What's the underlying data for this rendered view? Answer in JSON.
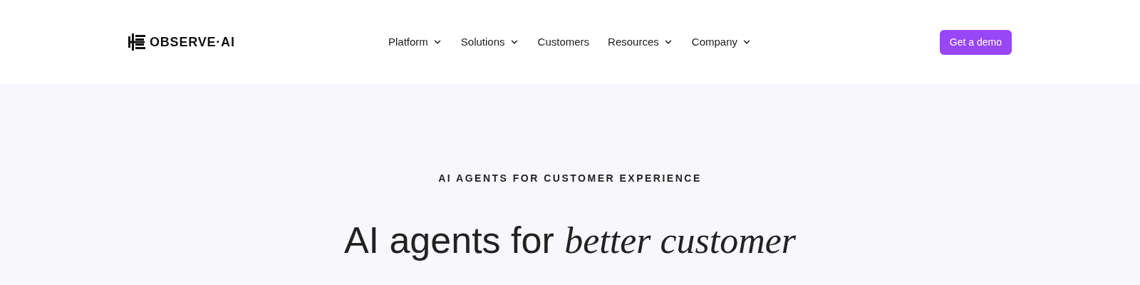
{
  "header": {
    "logo": "OBSERVE·AI",
    "nav": [
      {
        "label": "Platform",
        "dropdown": true
      },
      {
        "label": "Solutions",
        "dropdown": true
      },
      {
        "label": "Customers",
        "dropdown": false
      },
      {
        "label": "Resources",
        "dropdown": true
      },
      {
        "label": "Company",
        "dropdown": true
      }
    ],
    "cta": "Get a demo"
  },
  "hero": {
    "eyebrow": "AI AGENTS FOR CUSTOMER EXPERIENCE",
    "heading": "AI agents for *better customer*"
  }
}
